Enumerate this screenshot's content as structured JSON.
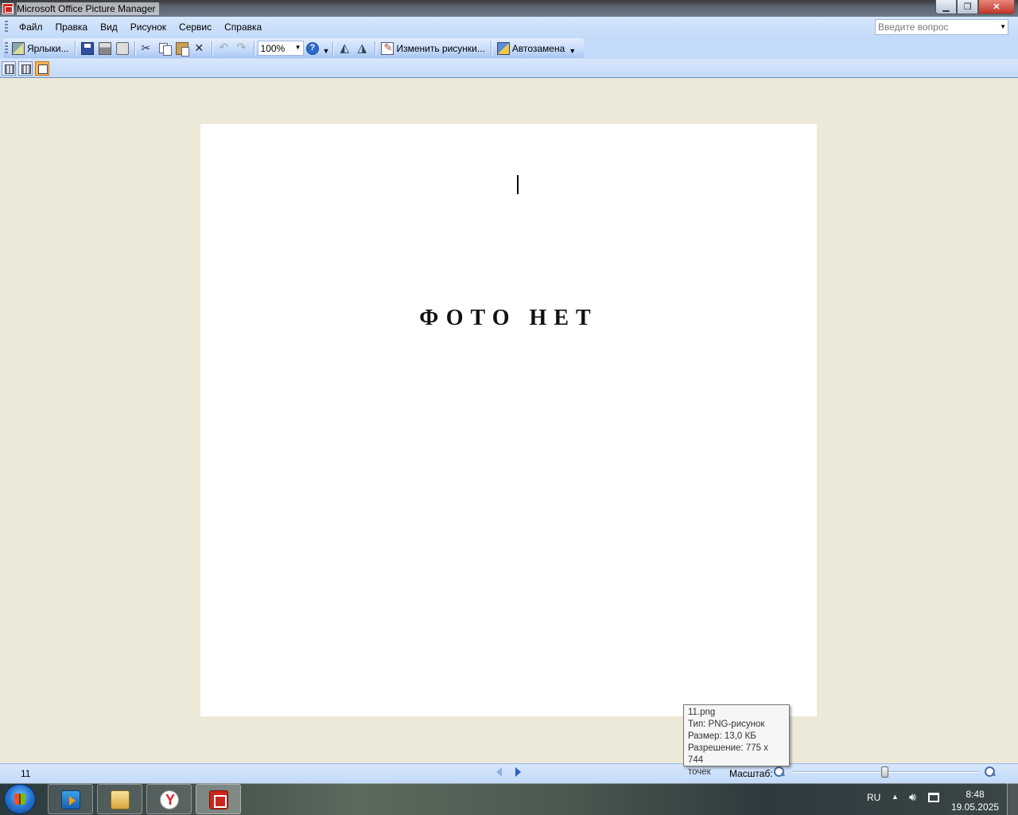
{
  "window": {
    "title": "Microsoft Office Picture Manager",
    "minimize_icon": "minimize-icon",
    "restore_icon": "restore-icon",
    "close_icon": "close-icon",
    "minimize_glyph": "▁",
    "restore_glyph": "❐",
    "close_glyph": "✕"
  },
  "menubar": {
    "items": [
      "Файл",
      "Правка",
      "Вид",
      "Рисунок",
      "Сервис",
      "Справка"
    ],
    "help_placeholder": "Введите вопрос"
  },
  "toolbar": {
    "shortcuts_label": "Ярлыки...",
    "zoom_value": "100%",
    "edit_pictures_label": "Изменить рисунки...",
    "autocorrect_label": "Автозамена"
  },
  "picture": {
    "text": "ФОТО НЕТ"
  },
  "tooltip": {
    "filename": "11.png",
    "type": "Тип: PNG-рисунок",
    "size": "Размер: 13,0 КБ",
    "resolution": "Разрешение: 775 x 744",
    "resolution_unit": "точек"
  },
  "statusbar": {
    "count": "11",
    "zoom_label": "Масштаб:",
    "zoom_slider_level": 0.5
  },
  "taskbar": {
    "language": "RU",
    "time": "8:48",
    "date": "19.05.2025"
  },
  "colors": {
    "menu_bg": "#c3daf9",
    "workspace_bg": "#ece9d8",
    "active_view": "#fbb550"
  }
}
